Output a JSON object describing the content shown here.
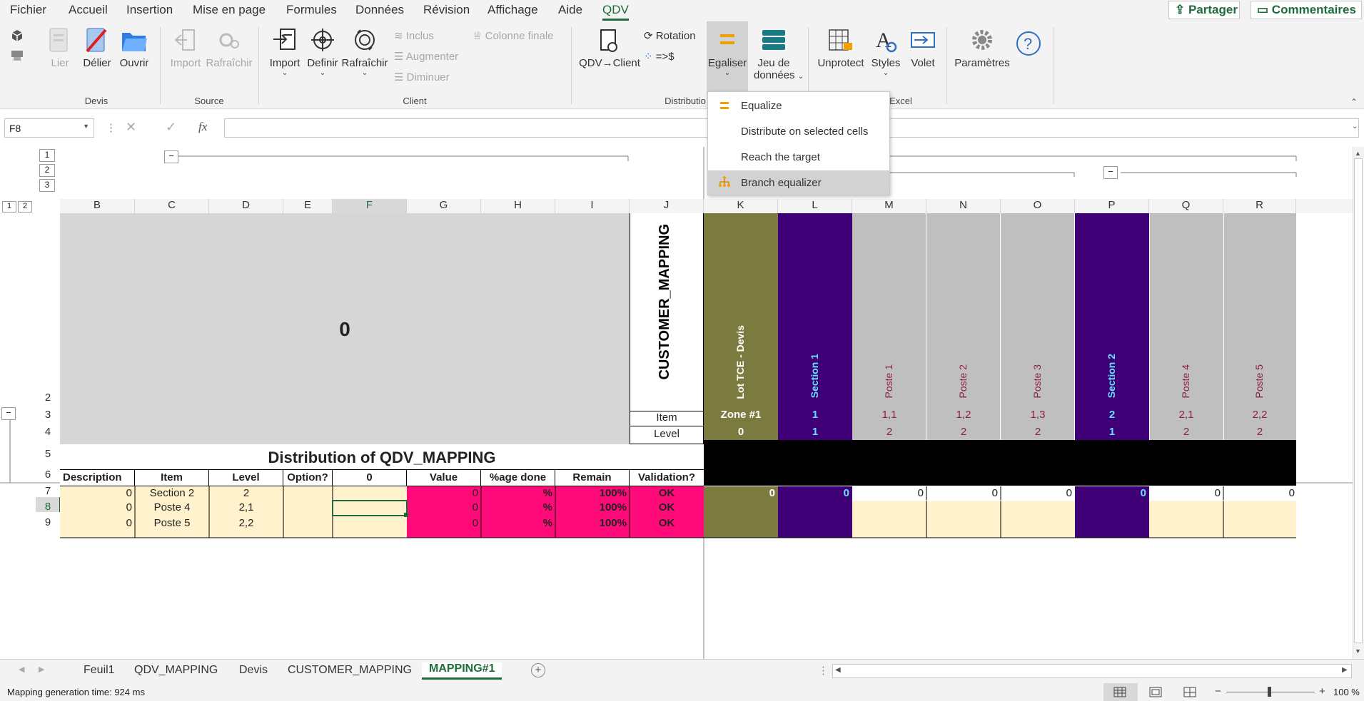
{
  "menu": {
    "tabs": [
      "Fichier",
      "Accueil",
      "Insertion",
      "Mise en page",
      "Formules",
      "Données",
      "Révision",
      "Affichage",
      "Aide",
      "QDV"
    ],
    "share_label": "Partager",
    "comments_label": "Commentaires"
  },
  "ribbon": {
    "devis": {
      "group": "Devis",
      "lier": "Lier",
      "delier": "Délier",
      "ouvrir": "Ouvrir"
    },
    "source": {
      "group": "Source",
      "import": "Import",
      "rafraichir": "Rafraîchir"
    },
    "client": {
      "group": "Client",
      "import": "Import",
      "definir": "Definir",
      "rafraichir": "Rafraîchir",
      "inclus": "Inclus",
      "augmenter": "Augmenter",
      "diminuer": "Diminuer",
      "colonne_finale": "Colonne finale"
    },
    "distribution": {
      "group": "Distributio",
      "qdv_client": "QDV→Client",
      "rotation": "Rotation",
      "to_dollar": "=>$",
      "egaliser": "Egaliser",
      "jeu_line1": "Jeu de",
      "jeu_line2": "données"
    },
    "excel": {
      "group": "Excel",
      "unprotect": "Unprotect",
      "styles": "Styles",
      "volet": "Volet"
    },
    "settings": {
      "parametres": "Paramètres"
    }
  },
  "formula_bar": {
    "name_box": "F8",
    "fx": "fx",
    "value": ""
  },
  "dropdown": {
    "items": [
      "Equalize",
      "Distribute on selected cells",
      "Reach the target",
      "Branch equalizer"
    ],
    "highlighted": "Branch equalizer"
  },
  "grid": {
    "outline_levels_rows": [
      "1",
      "2",
      "3"
    ],
    "outline_levels_cols": [
      "1",
      "2"
    ],
    "columns": [
      "B",
      "C",
      "D",
      "E",
      "F",
      "G",
      "H",
      "I",
      "J",
      "K",
      "L",
      "M",
      "N",
      "O",
      "P",
      "Q",
      "R"
    ],
    "rows": [
      "2",
      "3",
      "4",
      "5",
      "6",
      "7",
      "8",
      "9"
    ],
    "big_value": "0",
    "customer_mapping": "CUSTOMER_MAPPING",
    "item_label": "Item",
    "level_label": "Level",
    "title": "Distribution of QDV_MAPPING",
    "headers": [
      "Description",
      "Item",
      "Level",
      "Option?",
      "0",
      "Value",
      "%age done",
      "Remain",
      "Validation?"
    ],
    "data_rows": [
      {
        "desc": "0",
        "item": "Section 2",
        "level": "2",
        "option": "",
        "f": "",
        "value": "0",
        "pct": "%",
        "remain": "100%",
        "valid": "OK"
      },
      {
        "desc": "0",
        "item": "Poste 4",
        "level": "2,1",
        "option": "",
        "f": "",
        "value": "0",
        "pct": "%",
        "remain": "100%",
        "valid": "OK"
      },
      {
        "desc": "0",
        "item": "Poste 5",
        "level": "2,2",
        "option": "",
        "f": "",
        "value": "0",
        "pct": "%",
        "remain": "100%",
        "valid": "OK"
      }
    ],
    "mapping_cols": [
      {
        "name": "Lot TCE - Devis",
        "item": "Zone #1",
        "level": "0",
        "val": "0"
      },
      {
        "name": "Section 1",
        "item": "1",
        "level": "1",
        "val": "0"
      },
      {
        "name": "Poste 1",
        "item": "1,1",
        "level": "2",
        "val": "0"
      },
      {
        "name": "Poste 2",
        "item": "1,2",
        "level": "2",
        "val": "0"
      },
      {
        "name": "Poste 3",
        "item": "1,3",
        "level": "2",
        "val": "0"
      },
      {
        "name": "Section 2",
        "item": "2",
        "level": "1",
        "val": "0"
      },
      {
        "name": "Poste 4",
        "item": "2,1",
        "level": "2",
        "val": "0"
      },
      {
        "name": "Poste 5",
        "item": "2,2",
        "level": "2",
        "val": "0"
      }
    ]
  },
  "sheets": {
    "tabs": [
      "Feuil1",
      "QDV_MAPPING",
      "Devis",
      "CUSTOMER_MAPPING",
      "MAPPING#1"
    ],
    "active": "MAPPING#1"
  },
  "status": {
    "text": "Mapping generation time: 924 ms",
    "zoom": "100 %"
  },
  "colors": {
    "olive": "#7b7b3f",
    "purple": "#3f0077",
    "pink": "#ff0a78",
    "cream": "#fff2cc",
    "gray": "#bfbfbf",
    "excel_green": "#1e6b3c",
    "maroon": "#8b1f4a",
    "cyan": "#66e0ff"
  }
}
